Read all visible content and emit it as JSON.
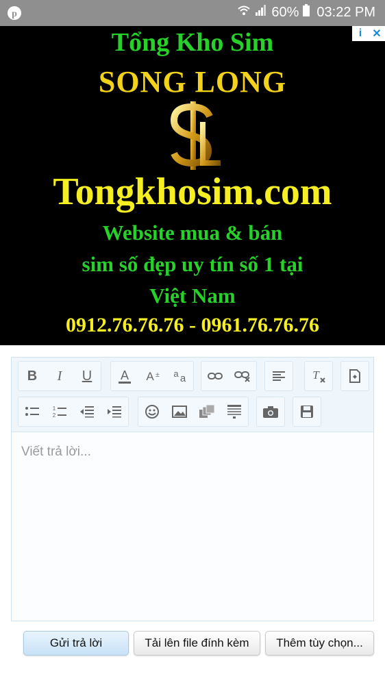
{
  "status_bar": {
    "battery": "60%",
    "time": "03:22 PM",
    "pinterest_icon": "pinterest-icon"
  },
  "ad": {
    "line1": "Tổng Kho Sim",
    "line2": "SONG LONG",
    "line3": "Tongkhosim.com",
    "line4": "Website mua & bán",
    "line5": "sim số đẹp uy tín số 1 tại",
    "line6": "Việt Nam",
    "line7": "0912.76.76.76 - 0961.76.76.76",
    "info_badge": "i",
    "close_badge": "✕"
  },
  "editor": {
    "placeholder": "Viết trả lời...",
    "toolbar_icons": [
      "bold-icon",
      "italic-icon",
      "underline-icon",
      "text-color-icon",
      "font-size-icon",
      "font-style-icon",
      "link-icon",
      "unlink-icon",
      "align-icon",
      "remove-format-icon",
      "bbcode-icon",
      "bullet-list-icon",
      "numbered-list-icon",
      "outdent-icon",
      "indent-icon",
      "smilie-icon",
      "image-icon",
      "media-icon",
      "quote-icon",
      "camera-icon",
      "save-draft-icon"
    ]
  },
  "actions": {
    "submit": "Gửi trả lời",
    "upload": "Tải lên file đính kèm",
    "more": "Thêm tùy chọn..."
  },
  "colors": {
    "ad_green": "#27d12a",
    "ad_yellow": "#f4ee22",
    "status_bar": "#8f8f8f"
  }
}
